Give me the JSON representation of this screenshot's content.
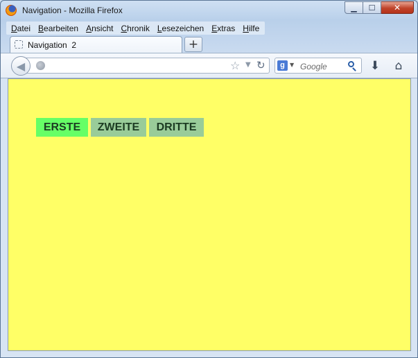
{
  "window": {
    "title": "Navigation - Mozilla Firefox",
    "controls": {
      "minimize": "▁",
      "maximize": "☐",
      "close": "✕"
    }
  },
  "menubar": {
    "items": [
      {
        "first": "D",
        "rest": "atei"
      },
      {
        "first": "B",
        "rest": "earbeiten"
      },
      {
        "first": "A",
        "rest": "nsicht"
      },
      {
        "first": "C",
        "rest": "hronik"
      },
      {
        "first": "L",
        "rest": "esezeichen"
      },
      {
        "first": "E",
        "rest": "xtras"
      },
      {
        "first": "H",
        "rest": "ilfe"
      }
    ]
  },
  "tabs": [
    {
      "label": "Navigation  2"
    }
  ],
  "newtab_label": "+",
  "navbar": {
    "back_glyph": "◀",
    "url_value": "",
    "star_glyph": "☆",
    "dropdown_glyph": "▼",
    "reload_glyph": "↻",
    "search_engine_glyph": "g",
    "engine_arrow": "▼",
    "search_placeholder": "Google",
    "download_glyph": "⬇",
    "home_glyph": "⌂"
  },
  "page": {
    "background": "#ffff66",
    "nav_links": [
      {
        "label": "ERSTE",
        "state": "active",
        "color": "#66ff66"
      },
      {
        "label": "ZWEITE",
        "state": "inactive",
        "color": "#99cc99"
      },
      {
        "label": "DRITTE",
        "state": "inactive",
        "color": "#99cc99"
      }
    ]
  }
}
